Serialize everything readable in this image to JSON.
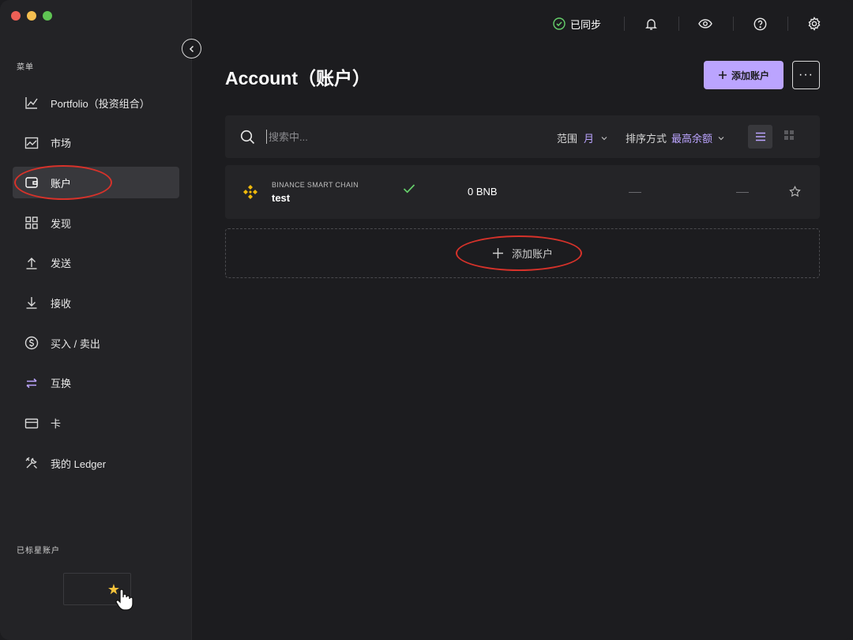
{
  "sidebar": {
    "menu_label": "菜单",
    "items": [
      {
        "label": "Portfolio（投资组合）",
        "icon": "portfolio-chart-icon"
      },
      {
        "label": "市场",
        "icon": "market-chart-icon"
      },
      {
        "label": "账户",
        "icon": "wallet-icon",
        "active": true
      },
      {
        "label": "发现",
        "icon": "grid-apps-icon"
      },
      {
        "label": "发送",
        "icon": "upload-arrow-icon"
      },
      {
        "label": "接收",
        "icon": "download-arrow-icon"
      },
      {
        "label": "买入 / 卖出",
        "icon": "dollar-circle-icon"
      },
      {
        "label": "互换",
        "icon": "swap-arrows-icon"
      },
      {
        "label": "卡",
        "icon": "card-icon"
      },
      {
        "label": "我的 Ledger",
        "icon": "tools-icon"
      }
    ],
    "starred_label": "已标星账户"
  },
  "topbar": {
    "sync_label": "已同步"
  },
  "main": {
    "title": "Account（账户）",
    "add_account_label": "添加账户",
    "more_label": "···",
    "search": {
      "placeholder": "搜索中..."
    },
    "range": {
      "label": "范围",
      "value": "月"
    },
    "sort": {
      "label": "排序方式",
      "value": "最高余额"
    },
    "accounts": [
      {
        "chain": "BINANCE SMART CHAIN",
        "name": "test",
        "balance": "0 BNB",
        "col1": "—",
        "col2": "—"
      }
    ],
    "add_zone_label": "添加账户"
  },
  "colors": {
    "accent": "#bba4ff",
    "success": "#66d06b",
    "annotation": "#d6322a",
    "binance": "#f0b90b",
    "star": "#f5c33b"
  }
}
